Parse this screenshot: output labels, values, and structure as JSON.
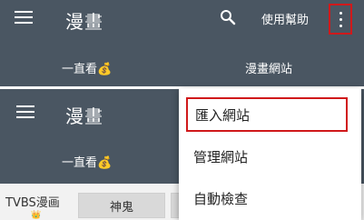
{
  "colors": {
    "toolbar": "#4a5662",
    "highlight_border": "#d0191b",
    "badge": "#e2b23a"
  },
  "top_bar": {
    "title": "漫畫",
    "help_label": "使用幫助",
    "tabs": [
      {
        "label": "一直看",
        "badge_icon": "money-bag-icon",
        "badge": "💰"
      },
      {
        "label": "漫畫網站"
      }
    ]
  },
  "second_bar": {
    "title": "漫畫",
    "tabs": [
      {
        "label": "一直看",
        "badge_icon": "money-bag-icon",
        "badge": "💰"
      }
    ]
  },
  "bottom": {
    "site_name": "TVBS漫画",
    "site_badge": "👑",
    "chips": [
      {
        "label": "神鬼"
      }
    ]
  },
  "dropdown": {
    "items": [
      {
        "label": "匯入網站",
        "highlighted": true
      },
      {
        "label": "管理網站"
      },
      {
        "label": "自動檢查"
      }
    ]
  }
}
